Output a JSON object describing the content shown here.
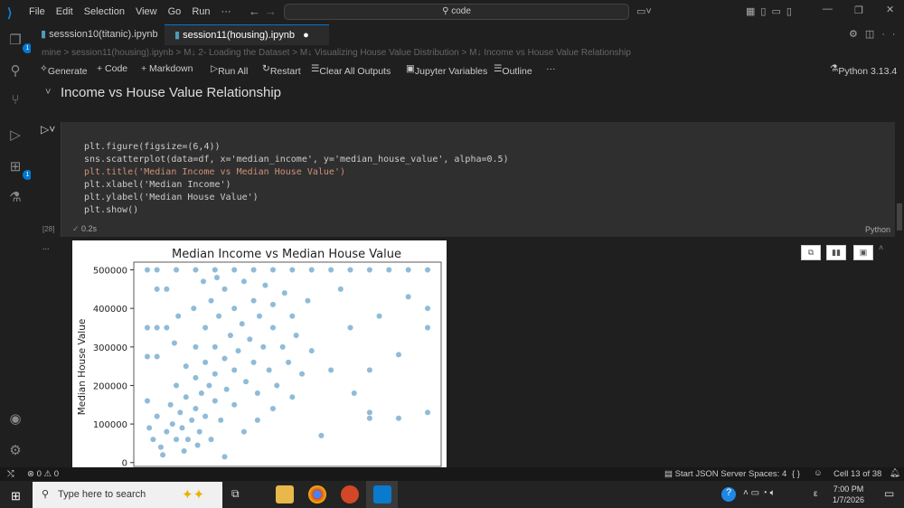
{
  "menu": [
    "File",
    "Edit",
    "Selection",
    "View",
    "Go",
    "Run",
    "···"
  ],
  "search": {
    "value": "code"
  },
  "tabs": [
    {
      "label": "sesssion10(titanic).ipynb"
    },
    {
      "label": "session11(housing).ipynb",
      "modified": "●"
    }
  ],
  "badges": {
    "explorer": "1",
    "extensions": "1"
  },
  "breadcrumb": [
    "mine",
    ">",
    "session11(housing).ipynb",
    ">",
    "M↓ 2- Loading the Dataset",
    ">",
    "M↓ Visualizing House Value Distribution",
    ">",
    "M↓ Income vs House Value Relationship"
  ],
  "toolbar": {
    "generate": "Generate",
    "code": "+ Code",
    "markdown": "+ Markdown",
    "run_all": "Run All",
    "restart": "Restart",
    "clear": "Clear All Outputs",
    "variables": "Jupyter Variables",
    "outline": "Outline",
    "more": "···",
    "kernel": "Python 3.13.4"
  },
  "heading": "Income vs House Value Relationship",
  "cell": {
    "exec_count": "[28]",
    "time": "0.2s",
    "language": "Python",
    "output_more": "...",
    "code": [
      "plt.figure(figsize=(6,4))",
      "sns.scatterplot(data=df, x='median_income', y='median_house_value', alpha=0.5)",
      "plt.title('Median Income vs Median House Value')",
      "plt.xlabel('Median Income')",
      "plt.ylabel('Median House Value')",
      "plt.show()"
    ]
  },
  "chart_data": {
    "type": "scatter",
    "title": "Median Income vs Median House Value",
    "xlabel": "Median Income",
    "ylabel": "Median House Value",
    "yticks": [
      "0",
      "100000",
      "200000",
      "300000",
      "400000",
      "500000"
    ],
    "ylim": [
      -10000,
      520000
    ],
    "xlim": [
      -0.2,
      15.7
    ],
    "color": "#1f77b4",
    "points": [
      [
        0.5,
        500000
      ],
      [
        1,
        500000
      ],
      [
        2,
        500000
      ],
      [
        3,
        500000
      ],
      [
        4,
        500000
      ],
      [
        5,
        500000
      ],
      [
        6,
        500000
      ],
      [
        7,
        500000
      ],
      [
        8,
        500000
      ],
      [
        9,
        500000
      ],
      [
        10,
        500000
      ],
      [
        11,
        500000
      ],
      [
        12,
        500000
      ],
      [
        13,
        500000
      ],
      [
        14,
        500000
      ],
      [
        15,
        500000
      ],
      [
        0.5,
        350000
      ],
      [
        1,
        350000
      ],
      [
        1.5,
        350000
      ],
      [
        0.5,
        275000
      ],
      [
        1,
        275000
      ],
      [
        0.5,
        160000
      ],
      [
        1,
        450000
      ],
      [
        1.5,
        450000
      ],
      [
        0.6,
        90000
      ],
      [
        0.8,
        60000
      ],
      [
        1,
        120000
      ],
      [
        1.2,
        40000
      ],
      [
        1.5,
        80000
      ],
      [
        1.7,
        150000
      ],
      [
        1.8,
        100000
      ],
      [
        2,
        60000
      ],
      [
        2,
        200000
      ],
      [
        2.2,
        130000
      ],
      [
        2.3,
        90000
      ],
      [
        2.5,
        250000
      ],
      [
        2.5,
        170000
      ],
      [
        2.6,
        60000
      ],
      [
        2.8,
        110000
      ],
      [
        3,
        300000
      ],
      [
        3,
        220000
      ],
      [
        3,
        140000
      ],
      [
        3.2,
        80000
      ],
      [
        3.3,
        180000
      ],
      [
        3.5,
        350000
      ],
      [
        3.5,
        260000
      ],
      [
        3.5,
        120000
      ],
      [
        3.7,
        200000
      ],
      [
        3.8,
        420000
      ],
      [
        4,
        300000
      ],
      [
        4,
        160000
      ],
      [
        4,
        230000
      ],
      [
        4.2,
        380000
      ],
      [
        4.3,
        110000
      ],
      [
        4.5,
        270000
      ],
      [
        4.5,
        450000
      ],
      [
        4.6,
        190000
      ],
      [
        4.8,
        330000
      ],
      [
        5,
        400000
      ],
      [
        5,
        240000
      ],
      [
        5,
        150000
      ],
      [
        5.2,
        290000
      ],
      [
        5.4,
        360000
      ],
      [
        5.5,
        470000
      ],
      [
        5.6,
        210000
      ],
      [
        5.8,
        320000
      ],
      [
        6,
        420000
      ],
      [
        6,
        260000
      ],
      [
        6.2,
        180000
      ],
      [
        6.3,
        380000
      ],
      [
        6.5,
        300000
      ],
      [
        6.6,
        460000
      ],
      [
        6.8,
        240000
      ],
      [
        7,
        350000
      ],
      [
        7,
        410000
      ],
      [
        7.2,
        200000
      ],
      [
        7.5,
        300000
      ],
      [
        7.6,
        440000
      ],
      [
        7.8,
        260000
      ],
      [
        8,
        380000
      ],
      [
        8.2,
        330000
      ],
      [
        8.5,
        230000
      ],
      [
        8.8,
        420000
      ],
      [
        9,
        290000
      ],
      [
        9.5,
        70000
      ],
      [
        10,
        240000
      ],
      [
        10.5,
        450000
      ],
      [
        11,
        350000
      ],
      [
        11.2,
        180000
      ],
      [
        12,
        240000
      ],
      [
        12,
        130000
      ],
      [
        12,
        115000
      ],
      [
        12.5,
        380000
      ],
      [
        13.5,
        280000
      ],
      [
        13.5,
        115000
      ],
      [
        14,
        430000
      ],
      [
        15,
        400000
      ],
      [
        15,
        350000
      ],
      [
        15,
        130000
      ],
      [
        1.3,
        20000
      ],
      [
        2.4,
        30000
      ],
      [
        3.1,
        45000
      ],
      [
        4.5,
        15000
      ],
      [
        3.8,
        60000
      ],
      [
        5.5,
        80000
      ],
      [
        6.2,
        110000
      ],
      [
        7,
        140000
      ],
      [
        8,
        170000
      ],
      [
        2.9,
        400000
      ],
      [
        1.9,
        310000
      ],
      [
        2.1,
        380000
      ],
      [
        4.1,
        480000
      ],
      [
        3.4,
        470000
      ]
    ]
  },
  "status": {
    "errors": "0",
    "warnings": "0",
    "json": "Start JSON Server",
    "spaces": "Spaces: 4",
    "braces": "{ }",
    "cell": "Cell 13 of 38"
  },
  "taskbar": {
    "search_placeholder": "Type here to search",
    "time": "7:00 PM",
    "date": "1/7/2026",
    "lang": "ε"
  }
}
